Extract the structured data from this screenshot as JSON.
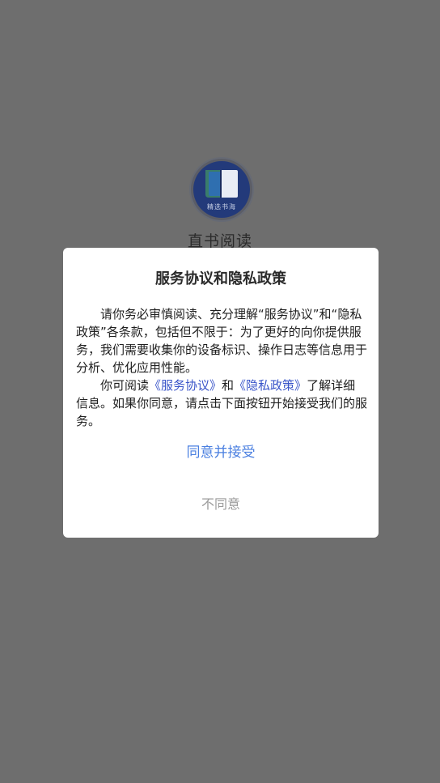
{
  "splash": {
    "logo_text": "精选书海",
    "app_name": "直书阅读"
  },
  "dialog": {
    "title": "服务协议和隐私政策",
    "paragraph1": "请你务必审慎阅读、充分理解“服务协议”和“隐私政策”各条款，包括但不限于：为了更好的向你提供服务，我们需要收集你的设备标识、操作日志等信息用于分析、优化应用性能。",
    "paragraph2_prefix": "你可阅读",
    "service_link": "《服务协议》",
    "and_text": "和",
    "privacy_link": "《隐私政策》",
    "paragraph2_suffix": "了解详细信息。如果你同意，请点击下面按钮开始接受我们的服务。",
    "agree_label": "同意并接受",
    "disagree_label": "不同意"
  },
  "colors": {
    "backdrop": "#6e6e6e",
    "link": "#3a55c9",
    "agree": "#4a7fe0",
    "disagree": "#9a9a9a"
  },
  "icons": {
    "logo": "book-logo-icon"
  }
}
